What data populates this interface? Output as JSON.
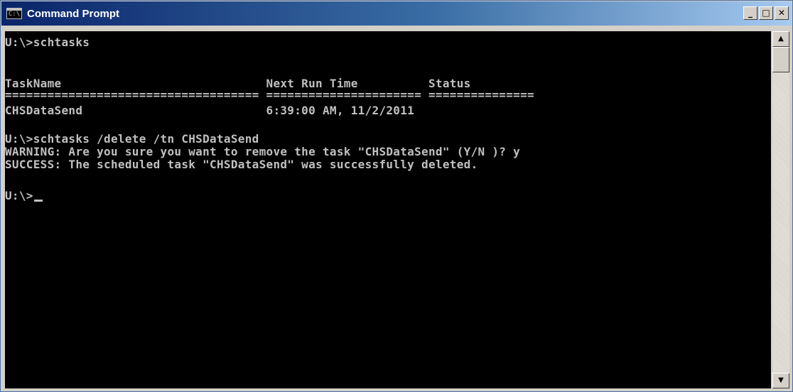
{
  "window": {
    "title": "Command Prompt",
    "icon_glyph": "C:\\",
    "minimize_glyph": "_",
    "maximize_glyph": "□",
    "close_glyph": "✕"
  },
  "console": {
    "lines": [
      "U:\\>schtasks",
      "TaskName                             Next Run Time          Status",
      "==================================== ====================== ===============",
      "CHSDataSend                          6:39:00 AM, 11/2/2011",
      "U:\\>schtasks /delete /tn CHSDataSend",
      "WARNING: Are you sure you want to remove the task \"CHSDataSend\" (Y/N )? y",
      "SUCCESS: The scheduled task \"CHSDataSend\" was successfully deleted.",
      "U:\\>"
    ]
  },
  "scrollbar": {
    "up_glyph": "▲",
    "down_glyph": "▼"
  },
  "colors": {
    "console_bg": "#000000",
    "console_fg": "#c0c0c0",
    "titlebar_start": "#0a246a",
    "titlebar_end": "#a6caf0"
  }
}
